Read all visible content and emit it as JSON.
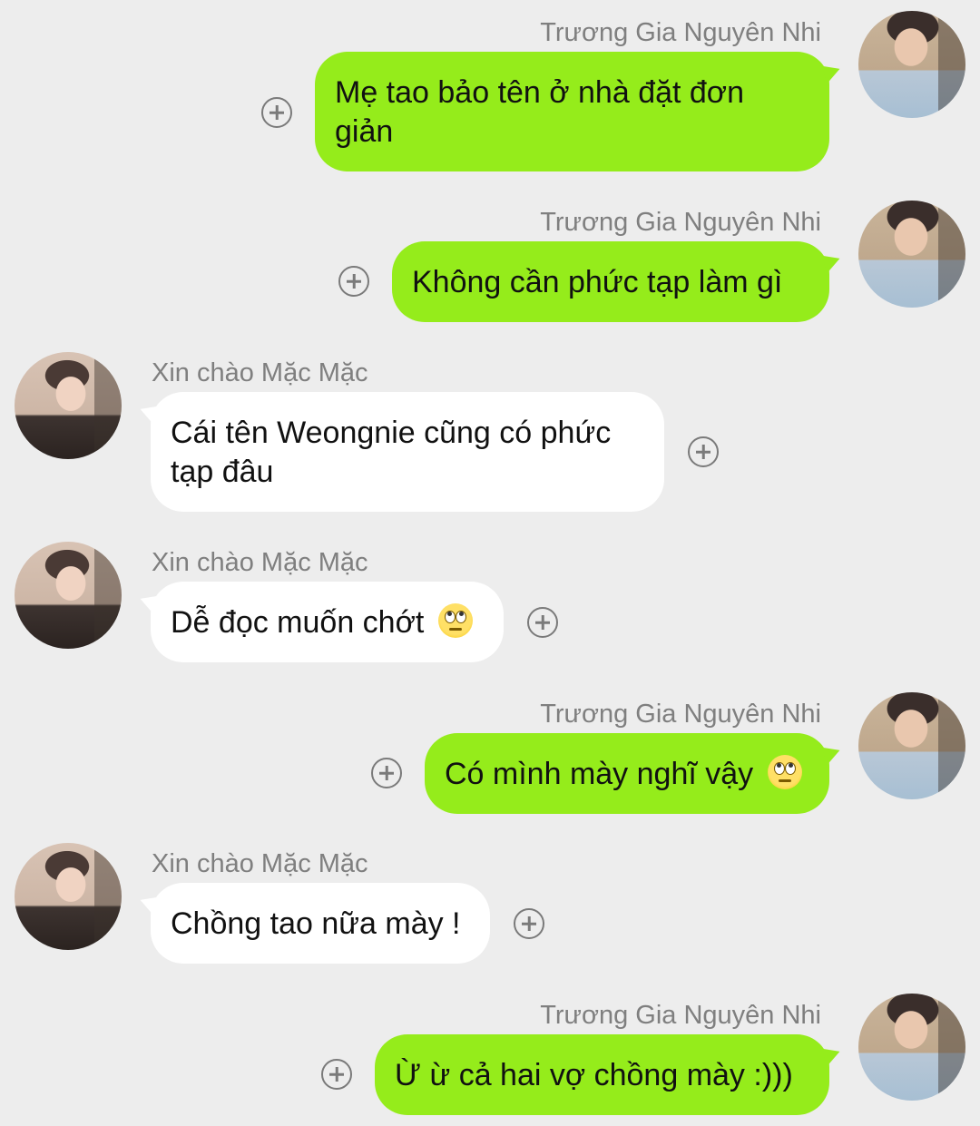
{
  "messages": [
    {
      "sender": "Trương Gia Nguyên Nhi",
      "text": "Mẹ tao bảo tên ở nhà đặt đơn giản",
      "side": "right",
      "emoji": false
    },
    {
      "sender": "Trương Gia Nguyên Nhi",
      "text": "Không cần phức tạp làm gì",
      "side": "right",
      "emoji": false
    },
    {
      "sender": "Xin chào Mặc Mặc",
      "text": "Cái tên Weongnie cũng có phức tạp đâu",
      "side": "left",
      "emoji": false
    },
    {
      "sender": "Xin chào Mặc Mặc",
      "text": "Dễ đọc muốn chớt",
      "side": "left",
      "emoji": "face-with-rolling-eyes"
    },
    {
      "sender": "Trương Gia Nguyên Nhi",
      "text": "Có mình mày nghĩ vậy",
      "side": "right",
      "emoji": "face-with-rolling-eyes"
    },
    {
      "sender": "Xin chào Mặc Mặc",
      "text": "Chồng tao nữa mày !",
      "side": "left",
      "emoji": false
    },
    {
      "sender": "Trương Gia Nguyên Nhi",
      "text": "Ừ ừ cả hai vợ chồng mày :)))",
      "side": "right",
      "emoji": false
    }
  ],
  "colors": {
    "background": "#ededed",
    "outgoing_bubble": "#95ec1b",
    "incoming_bubble": "#ffffff",
    "sender_name": "#7f7f7f"
  },
  "icons": {
    "react_button": "plus-circle-icon"
  }
}
